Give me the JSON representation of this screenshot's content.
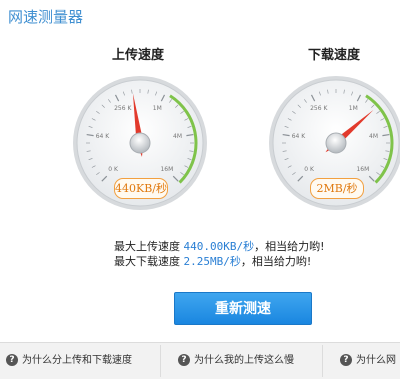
{
  "app": {
    "title": "网速测量器"
  },
  "upload": {
    "label": "上传速度",
    "readout": "440KB/秒",
    "needle_fraction": 0.47,
    "tick_labels": [
      "0 K",
      "64 K",
      "256 K",
      "1M",
      "4M",
      "16M"
    ]
  },
  "download": {
    "label": "下载速度",
    "readout": "2MB/秒",
    "needle_fraction": 0.68,
    "tick_labels": [
      "0 K",
      "64 K",
      "256 K",
      "1M",
      "4M",
      "16M"
    ]
  },
  "results": {
    "upload_prefix": "最大上传速度",
    "upload_value": "440.00KB/秒",
    "upload_suffix": "，相当给力哟!",
    "download_prefix": "最大下载速度",
    "download_value": "2.25MB/秒",
    "download_suffix": "，相当给力哟!"
  },
  "retest_button": {
    "label": "重新测速"
  },
  "faq": [
    {
      "label": "为什么分上传和下载速度"
    },
    {
      "label": "为什么我的上传这么慢"
    },
    {
      "label": "为什么网"
    }
  ],
  "colors": {
    "accent": "#3f8fd1",
    "needle": "#e23a2c",
    "arc": "#7fc34a",
    "readout": "#e07a10",
    "button": "#1a86e0"
  }
}
